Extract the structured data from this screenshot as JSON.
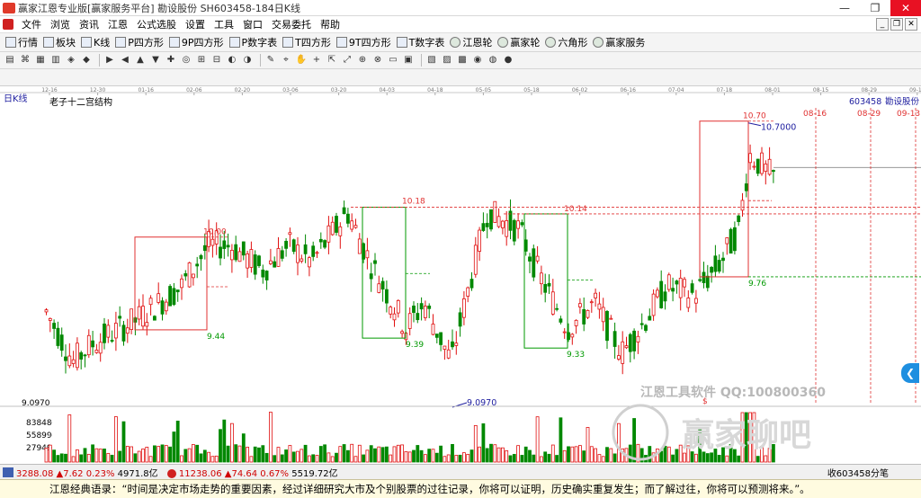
{
  "window": {
    "title": "赢家江恩专业版[赢家服务平台]  勘设股份  SH603458-184日K线",
    "min_label": "—",
    "max_label": "❐",
    "close_label": "✕"
  },
  "menubar": {
    "items": [
      "文件",
      "浏览",
      "资讯",
      "江恩",
      "公式选股",
      "设置",
      "工具",
      "窗口",
      "交易委托",
      "帮助"
    ]
  },
  "toolbar1": {
    "items": [
      {
        "label": "行情",
        "icon": "grid-icon"
      },
      {
        "label": "板块",
        "icon": "blocks-icon"
      },
      {
        "label": "K线",
        "icon": "candlestick-icon"
      },
      {
        "label": "P四方形",
        "icon": "p-square-icon"
      },
      {
        "label": "9P四方形",
        "icon": "9p-square-icon"
      },
      {
        "label": "P数字表",
        "icon": "p-table-icon"
      },
      {
        "label": "T四方形",
        "icon": "t-square-icon"
      },
      {
        "label": "9T四方形",
        "icon": "9t-square-icon"
      },
      {
        "label": "T数字表",
        "icon": "t-table-icon"
      },
      {
        "label": "江恩轮",
        "icon": "gann-wheel-icon"
      },
      {
        "label": "赢家轮",
        "icon": "winner-wheel-icon"
      },
      {
        "label": "六角形",
        "icon": "hexagon-icon"
      },
      {
        "label": "赢家服务",
        "icon": "dollar-icon"
      }
    ]
  },
  "chart": {
    "period_label": "日K线",
    "indicator_label": "老子十二宫结构",
    "stock_code": "603458",
    "stock_name": "勘设股份",
    "date_ticks": [
      "12-16",
      "12-30",
      "01-16",
      "02-06",
      "02-20",
      "03-06",
      "03-20",
      "04-03",
      "04-18",
      "05-05",
      "05-18",
      "06-02",
      "06-16",
      "07-04",
      "07-18",
      "08-01",
      "08-15",
      "08-29",
      "09-12"
    ],
    "future_dates": [
      "08-16",
      "08-29",
      "09-13"
    ],
    "price_labels": {
      "p1000": "10.00",
      "p944": "9.44",
      "p1018": "10.18",
      "p939": "9.39",
      "p1014": "10.14",
      "p933": "9.33",
      "p1070": "10.70",
      "p107000": "10.7000",
      "p976": "9.76",
      "low": "9.0970",
      "low_left": "9.0970"
    },
    "volume_ticks": [
      "83848",
      "55899",
      "27949"
    ],
    "volume_marker": "$",
    "watermark_text": "江恩工具软件  QQ:100800360",
    "watermark_brand": "赢家聊吧",
    "colors": {
      "up": "#e01010",
      "down": "#008800",
      "box_red": "#e03030",
      "box_green": "#009900",
      "accent_blue": "#2020a0"
    }
  },
  "chart_data": {
    "type": "candlestick",
    "title": "老子十二宫结构",
    "x": [
      "12-16",
      "12-30",
      "01-16",
      "02-06",
      "02-20",
      "03-06",
      "03-20",
      "04-03",
      "04-18",
      "05-05",
      "05-18",
      "06-02",
      "06-16",
      "07-04",
      "07-18",
      "08-01"
    ],
    "close_approx": [
      9.55,
      9.35,
      9.5,
      9.95,
      9.75,
      9.95,
      10.1,
      9.55,
      9.4,
      10.05,
      9.8,
      9.45,
      9.5,
      9.6,
      9.95,
      10.45
    ],
    "annotations": [
      {
        "label": "10.00",
        "type": "box-high"
      },
      {
        "label": "9.44",
        "type": "box-low"
      },
      {
        "label": "10.18",
        "type": "level"
      },
      {
        "label": "9.39",
        "type": "box-low"
      },
      {
        "label": "10.14",
        "type": "level"
      },
      {
        "label": "9.33",
        "type": "box-low"
      },
      {
        "label": "10.70",
        "type": "box-high"
      },
      {
        "label": "9.76",
        "type": "box-low"
      },
      {
        "label": "9.0970",
        "type": "period-low"
      }
    ],
    "ylim": [
      9.0,
      10.8
    ],
    "volume_ticks": [
      27949,
      55899,
      83848
    ]
  },
  "statusbar": {
    "sh_index": "3288.08",
    "sh_change": "▲7.62",
    "sh_pct": "0.23%",
    "sh_amount": "4971.8亿",
    "sz_index": "11238.06",
    "sz_change": "▲74.64",
    "sz_pct": "0.67%",
    "sz_amount": "5519.72亿",
    "right_text": "收603458分笔"
  },
  "quote": {
    "text": "江恩经典语录：“时间是决定市场走势的重要因素，经过详细研究大市及个别股票的过往记录，你将可以证明，历史确实重复发生；而了解过往，你将可以预测将来。”。"
  }
}
